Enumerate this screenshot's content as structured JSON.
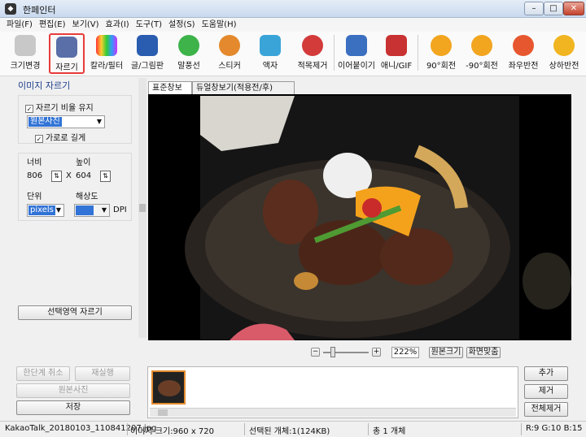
{
  "title": "한페인터",
  "menu": [
    "파일(F)",
    "편집(E)",
    "보기(V)",
    "효과(I)",
    "도구(T)",
    "설정(S)",
    "도움말(H)"
  ],
  "toolbar": [
    {
      "label": "크기변경",
      "icon": "resize-icon"
    },
    {
      "label": "자르기",
      "icon": "crop-icon"
    },
    {
      "label": "칼라/필터",
      "icon": "color-filter-icon"
    },
    {
      "label": "글/그림판",
      "icon": "text-draw-icon"
    },
    {
      "label": "말풍선",
      "icon": "speech-bubble-icon"
    },
    {
      "label": "스티커",
      "icon": "sticker-icon"
    },
    {
      "label": "액자",
      "icon": "frame-icon"
    },
    {
      "label": "적목제거",
      "icon": "red-eye-icon"
    },
    {
      "label": "이어붙이기",
      "icon": "merge-icon"
    },
    {
      "label": "애니/GIF",
      "icon": "animation-icon"
    },
    {
      "label": "90°회전",
      "icon": "rotate-right-icon"
    },
    {
      "label": "-90°회전",
      "icon": "rotate-left-icon"
    },
    {
      "label": "좌우반전",
      "icon": "flip-horizontal-icon"
    },
    {
      "label": "상하반전",
      "icon": "flip-vertical-icon"
    }
  ],
  "panel": {
    "heading": "이미지 자르기",
    "keep_ratio": "자르기 비율 유지",
    "ratio_select": "원본사진",
    "landscape": "가로로 길게",
    "width_label": "너비",
    "height_label": "높이",
    "width": "806",
    "x_sep": "X",
    "height": "604",
    "unit_label": "단위",
    "res_label": "해상도",
    "unit": "pixels",
    "dpi": "DPI",
    "crop_button": "선택영역 자르기"
  },
  "tabs": [
    "표준창보기",
    "듀얼창보기(적용전/후)"
  ],
  "zoom": {
    "minus": "−",
    "plus": "+",
    "value": "222%",
    "fit_original": "원본크기",
    "fit_screen": "화면맞춤",
    "level": 0.22
  },
  "actions": {
    "undo": "한단계 취소",
    "redo": "재실행",
    "original": "원본사진",
    "save": "저장"
  },
  "list_buttons": {
    "add": "추가",
    "remove": "제거",
    "remove_all": "전체제거"
  },
  "status": {
    "filename": "KakaoTalk_20180103_110841207.jpg",
    "size": "이미지 크기:960 x 720",
    "selected": "선택된 개체:1(124KB)",
    "total": "총 1 개체",
    "rgb": "R:9 G:10 B:15"
  },
  "colors": {
    "accent": "#3173d6",
    "highlight": "#e83b3b",
    "canvas": "#000000"
  }
}
